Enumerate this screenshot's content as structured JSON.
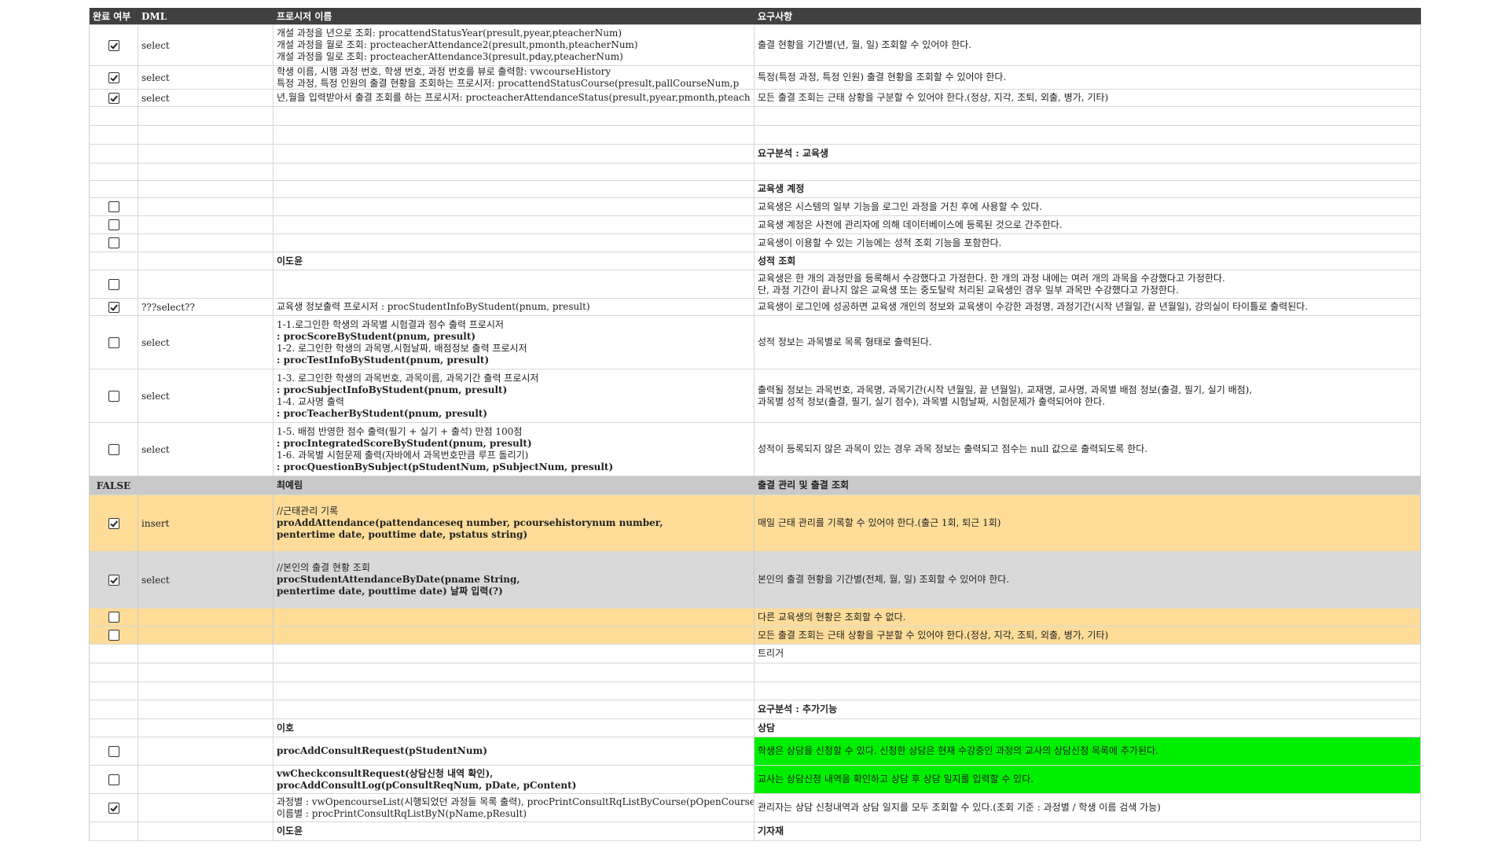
{
  "header": {
    "col0": "완료 여부",
    "col1": "DML",
    "col2": "프로시저 이름",
    "col3": "요구사항"
  },
  "rows": [
    {
      "check": true,
      "dml": "select",
      "proc": [
        "개설 과정을 년으로 조회: procattendStatusYear(presult,pyear,pteacherNum)",
        "개설 과정을 월로 조회:  procteacherAttendance2(presult,pmonth,pteacherNum)",
        "개설 과정을 일로 조회:  procteacherAttendance3(presult,pday,pteacherNum)"
      ],
      "req": [
        "출결 현황을 기간별(년, 월, 일) 조회할 수 있어야 한다."
      ]
    },
    {
      "check": true,
      "dml": "select",
      "proc": [
        "학생 이름, 시행 과정 번호, 학생 번호, 과정 번호를 뷰로 출력함: vwcourseHistory",
        "특정 과정, 특정 인원의 출결 현황을 조회하는 프로시저: procattendStatusCourse(presult,pallCourseNum,p"
      ],
      "req": [
        "특정(특정 과정, 특정 인원) 출결 현황을 조회할 수 있어야 한다."
      ]
    },
    {
      "check": true,
      "dml": "select",
      "proc": [
        "년,월을 입력받아서 출결 조회를 하는 프로시저: procteacherAttendanceStatus(presult,pyear,pmonth,pteach"
      ],
      "req": [
        "모든 출결 조회는 근태 상황을 구분할 수 있어야 한다.(정상, 지각, 조퇴, 외출, 병가, 기타)"
      ]
    },
    {
      "check": null,
      "dml": "",
      "proc": [
        ""
      ],
      "req": [
        ""
      ]
    },
    {
      "check": null,
      "dml": "",
      "proc": [
        ""
      ],
      "req": [
        ""
      ]
    },
    {
      "check": null,
      "dml": "",
      "proc": [
        ""
      ],
      "req": [
        "요구분석 : 교육생"
      ]
    },
    {
      "check": null,
      "dml": "",
      "proc": [
        ""
      ],
      "req": [
        ""
      ]
    },
    {
      "check": null,
      "dml": "",
      "proc": [
        ""
      ],
      "req": [
        "교육생 계정"
      ]
    },
    {
      "check": false,
      "dml": "",
      "proc": [
        ""
      ],
      "req": [
        "교육생은 시스템의 일부 기능을 로그인 과정을 거친 후에 사용할 수 있다."
      ]
    },
    {
      "check": false,
      "dml": "",
      "proc": [
        ""
      ],
      "req": [
        "교육생 계정은 사전에 관리자에 의해 데이터베이스에 등록된 것으로 간주한다."
      ]
    },
    {
      "check": false,
      "dml": "",
      "proc": [
        ""
      ],
      "req": [
        "교육생이 이용할 수 있는 기능에는 성적 조회 기능을 포함한다."
      ]
    },
    {
      "check": null,
      "dml": "",
      "proc": [
        "이도윤"
      ],
      "req": [
        "성적 조회"
      ]
    },
    {
      "check": false,
      "dml": "",
      "proc": [
        ""
      ],
      "req": [
        "교육생은 한 개의 과정만을 등록해서 수강했다고 가정한다. 한 개의 과정 내에는 여러 개의 과목을 수강했다고 가정한다.",
        "단, 과정 기간이 끝나지 않은 교육생 또는 중도탈락 처리된 교육생인 경우 일부 과목만 수강했다고 가정한다."
      ]
    },
    {
      "check": true,
      "dml": "???select??",
      "proc": [
        "교육생 정보출력 프로시저 : procStudentInfoByStudent(pnum, presult)"
      ],
      "req": [
        "교육생이 로그인에 성공하면 교육생 개인의 정보와 교육생이 수강한 과정명, 과정기간(시작 년월일, 끝 년월일), 강의실이 타이틀로 출력된다."
      ]
    },
    {
      "check": false,
      "dml": "select",
      "proc": [
        "1-1.로그인한 학생의 과목별 시험결과 점수 출력 프로시저",
        ": procScoreByStudent(pnum, presult)",
        "1-2. 로그인한 학생의 과목명,시험날짜, 배점정보 출력 프로시저",
        ": procTestInfoByStudent(pnum, presult)"
      ],
      "req": [
        "성적 정보는 과목별로 목록 형태로 출력된다."
      ]
    },
    {
      "check": false,
      "dml": "select",
      "proc": [
        "1-3. 로그인한 학생의 과목번호, 과목이름, 과목기간 출력 프로시저",
        ": procSubjectInfoByStudent(pnum, presult)",
        "1-4. 교사명 출력",
        ": procTeacherByStudent(pnum, presult)"
      ],
      "req": [
        "출력될 정보는 과목번호, 과목명, 과목기간(시작 년월일, 끝 년월일), 교재명, 교사명, 과목별 배점 정보(출결, 필기, 실기 배점),",
        "과목별 성적 정보(출결, 필기, 실기 점수), 과목별 시험날짜, 시험문제가 출력되어야 한다."
      ]
    },
    {
      "check": false,
      "dml": "select",
      "proc": [
        "1-5. 배점 반영한 점수 출력(필기 + 실기 + 출석) 만점 100점",
        ": procIntegratedScoreByStudent(pnum, presult)",
        "1-6. 과목별 시험문제 출력(자바에서 과목번호만큼 루프 돌리기)",
        ": procQuestionBySubject(pStudentNum, pSubjectNum, presult)"
      ],
      "req": [
        "성적이 등록되지 않은 과목이 있는 경우 과목 정보는 출력되고 점수는 null 값으로 출력되도록 한다."
      ]
    },
    {
      "check": "FALSE",
      "dml": "",
      "proc": [
        "최예림"
      ],
      "req": [
        "출결 관리 및 출결 조회"
      ]
    },
    {
      "check": true,
      "dml": "insert",
      "proc": [
        "//근태관리 기록",
        "proAddAttendance(pattendanceseq number, pcoursehistorynum number,",
        "pentertime date, pouttime date, pstatus string)"
      ],
      "req": [
        "매일 근태 관리를 기록할 수 있어야 한다.(출근 1회, 퇴근 1회)"
      ]
    },
    {
      "check": true,
      "dml": "select",
      "proc": [
        "//본인의 출결 현황 조회",
        "procStudentAttendanceByDate(pname String,",
        "pentertime date, pouttime date) 날짜 입력(?)"
      ],
      "req": [
        "본인의 출결 현황을 기간별(전체, 월, 일) 조회할 수 있어야 한다."
      ]
    },
    {
      "check": false,
      "dml": "",
      "proc": [
        ""
      ],
      "req": [
        "다른 교육생의 현황은 조회할 수 없다."
      ]
    },
    {
      "check": false,
      "dml": "",
      "proc": [
        ""
      ],
      "req": [
        "모든 출결 조회는 근태 상황을 구분할 수 있어야 한다.(정상, 지각, 조퇴, 외출, 병가, 기타)"
      ]
    },
    {
      "check": null,
      "dml": "",
      "proc": [
        ""
      ],
      "req": [
        "트리거"
      ]
    },
    {
      "check": null,
      "dml": "",
      "proc": [
        ""
      ],
      "req": [
        ""
      ]
    },
    {
      "check": null,
      "dml": "",
      "proc": [
        ""
      ],
      "req": [
        ""
      ]
    },
    {
      "check": null,
      "dml": "",
      "proc": [
        ""
      ],
      "req": [
        "요구분석 : 추가기능"
      ]
    },
    {
      "check": null,
      "dml": "",
      "proc": [
        "이호"
      ],
      "req": [
        "상담"
      ]
    },
    {
      "check": false,
      "dml": "",
      "proc": [
        "procAddConsultRequest(pStudentNum)"
      ],
      "req": [
        "학생은 상담을 신청할 수 있다. 신청한 상담은 현재 수강중인 과정의 교사의 상담신청 목록에 추가된다."
      ]
    },
    {
      "check": false,
      "dml": "",
      "proc": [
        "vwCheckconsultRequest(상담신청 내역 확인),",
        "procAddConsultLog(pConsultReqNum, pDate, pContent)"
      ],
      "req": [
        "교사는 상담신청 내역을 확인하고 상담 후 상담 일지를  입력할 수 있다."
      ]
    },
    {
      "check": true,
      "dml": "",
      "proc": [
        "과정별 : vwOpencourseList(시행되었던 과정들 목록 출력), procPrintConsultRqListByCourse(pOpenCourse",
        "이름별 : procPrintConsultRqListByN(pName,pResult)"
      ],
      "req": [
        "관리자는 상담 신청내역과 상담 일지를 모두 조회할 수 있다.(조회 기준 : 과정별 / 학생 이름 검색 가능)"
      ]
    },
    {
      "check": null,
      "dml": "",
      "proc": [
        "이도윤"
      ],
      "req": [
        "기자재"
      ]
    }
  ]
}
